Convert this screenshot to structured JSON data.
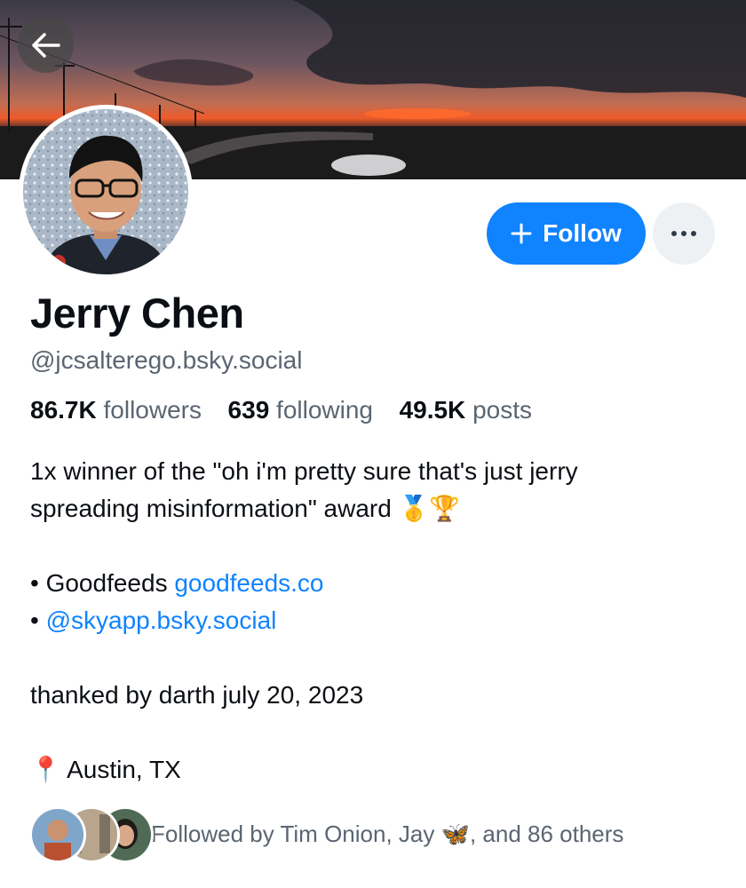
{
  "header": {
    "back_icon": "arrow-left-icon"
  },
  "profile": {
    "display_name": "Jerry Chen",
    "handle": "@jcsalterego.bsky.social",
    "follow_label": "Follow",
    "follow_icon": "plus-icon",
    "more_icon": "ellipsis-icon",
    "accent_color": "#1083fe"
  },
  "stats": {
    "followers_count": "86.7K",
    "followers_label": "followers",
    "following_count": "639",
    "following_label": "following",
    "posts_count": "49.5K",
    "posts_label": "posts"
  },
  "bio": {
    "line1": "1x winner of the \"oh i'm pretty sure that's just jerry",
    "line2": "spreading misinformation\" award 🥇🏆",
    "bullet1_prefix": "• Goodfeeds ",
    "bullet1_link": "goodfeeds.co",
    "bullet2_prefix": "• ",
    "bullet2_link": "@skyapp.bsky.social",
    "thanked": "thanked by darth july 20, 2023",
    "location": "📍 Austin, TX"
  },
  "followed_by": {
    "text": "Followed by Tim Onion, Jay 🦋, and 86 others"
  }
}
